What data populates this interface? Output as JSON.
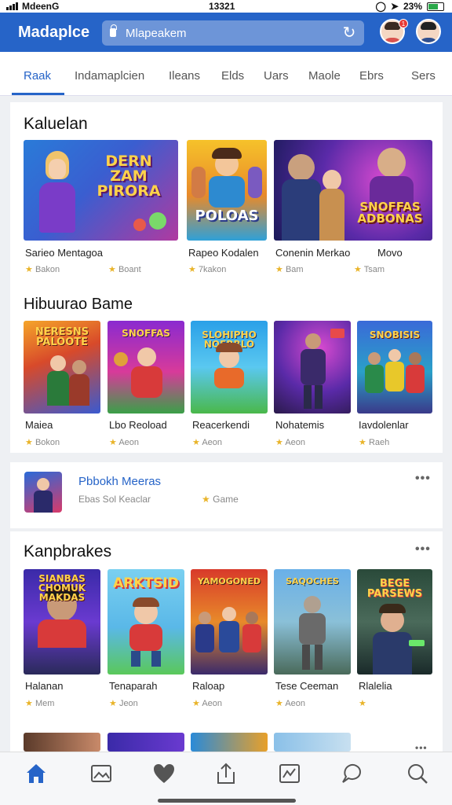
{
  "status": {
    "carrier": "MdeenG",
    "time": "13321",
    "battery": "23%"
  },
  "header": {
    "app_title": "Madaplce",
    "search_value": "Mlapeakem",
    "notification_count": "1"
  },
  "tabs": [
    "Raak",
    "Indamaplcien",
    "Ileans",
    "Elds",
    "Uars",
    "Maole",
    "Ebrs",
    "Sers"
  ],
  "sections": [
    {
      "title": "Kaluelan",
      "cards": [
        {
          "title": "Sarieo Mentagoa",
          "meta": "Bakon",
          "art": "DERN ZAM PIRORA"
        },
        {
          "title": "",
          "meta": "Boant",
          "art": ""
        },
        {
          "title": "Rapeo Kodalen",
          "meta": "7kakon",
          "art": "POLOAS"
        },
        {
          "title": "Conenin Merkao",
          "meta": "Bam",
          "art": ""
        },
        {
          "title": "Movo",
          "meta": "Tsam",
          "art": "SNOFFAS ADBONAS"
        }
      ]
    },
    {
      "title": "Hibuurao Bame",
      "cards": [
        {
          "title": "Maiea",
          "meta": "Bokon",
          "art": "NERESNS PALOOTE"
        },
        {
          "title": "Lbo Reoload",
          "meta": "Aeon",
          "art": "SNOFFAS"
        },
        {
          "title": "Reacerkendi",
          "meta": "Aeon",
          "art": "SLOHIPHO NOFRBLO"
        },
        {
          "title": "Nohatemis",
          "meta": "Aeon",
          "art": ""
        },
        {
          "title": "Iavdolenlar",
          "meta": "Raeh",
          "art": "SNOBISIS"
        }
      ]
    },
    {
      "title": "Kanpbrakes",
      "cards": [
        {
          "title": "Halanan",
          "meta": "Mem",
          "art": "SIANBAS CHOMUK MAKDAS"
        },
        {
          "title": "Tenaparah",
          "meta": "Jeon",
          "art": "ARKTSID"
        },
        {
          "title": "Raloap",
          "meta": "Aeon",
          "art": "YAMOGONED"
        },
        {
          "title": "Tese Ceeman",
          "meta": "Aeon",
          "art": "SAQOCHES"
        },
        {
          "title": "Rlalelia",
          "meta": "",
          "art": "BEGE PARSEWS"
        }
      ]
    }
  ],
  "list_item": {
    "title": "Pbbokh Meeras",
    "subtitle": "Ebas Sol Keaclar",
    "tag": "Game"
  },
  "more_label": "•••",
  "colors": {
    "accent": "#2664c8",
    "star": "#e9b42a"
  },
  "bottom_nav": [
    "home-icon",
    "gallery-icon",
    "heart-icon",
    "share-icon",
    "chart-icon",
    "chat-icon",
    "search-icon"
  ]
}
